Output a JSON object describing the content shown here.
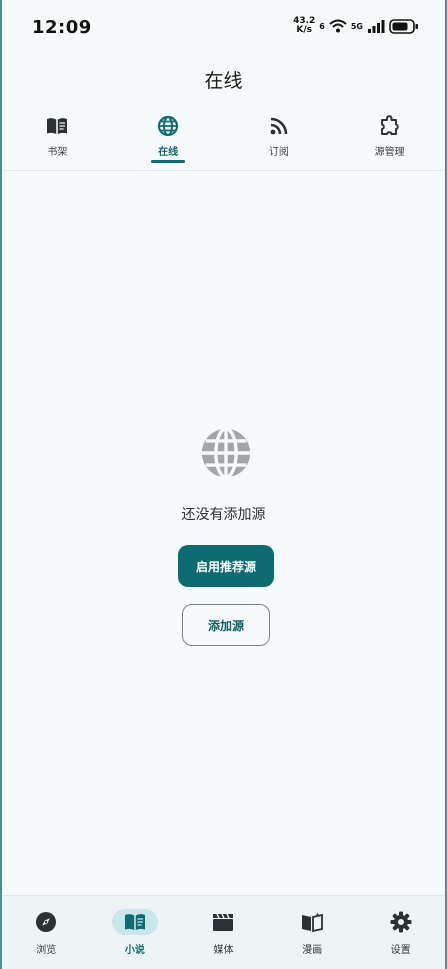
{
  "status_bar": {
    "time": "12:09",
    "net_speed_value": "43.2",
    "net_speed_unit": "K/s",
    "wifi_badge": "6",
    "cell_label": "5G"
  },
  "header": {
    "title": "在线"
  },
  "tabs": [
    {
      "label": "书架",
      "icon": "book-open-icon",
      "active": false
    },
    {
      "label": "在线",
      "icon": "globe-icon",
      "active": true
    },
    {
      "label": "订阅",
      "icon": "rss-icon",
      "active": false
    },
    {
      "label": "源管理",
      "icon": "puzzle-icon",
      "active": false
    }
  ],
  "empty_state": {
    "icon": "globe-icon",
    "message": "还没有添加源",
    "primary_button": "启用推荐源",
    "secondary_button": "添加源"
  },
  "bottom_nav": [
    {
      "label": "浏览",
      "icon": "compass-icon",
      "active": false
    },
    {
      "label": "小说",
      "icon": "book-icon",
      "active": true
    },
    {
      "label": "媒体",
      "icon": "clapperboard-icon",
      "active": false
    },
    {
      "label": "漫画",
      "icon": "comic-book-icon",
      "active": false
    },
    {
      "label": "设置",
      "icon": "gear-icon",
      "active": false
    }
  ],
  "colors": {
    "accent": "#0e6b72",
    "background": "#f6fafb",
    "nav_background": "#eef4f5",
    "active_pill": "#c9e7ea",
    "muted_icon": "#a3a6a8"
  }
}
